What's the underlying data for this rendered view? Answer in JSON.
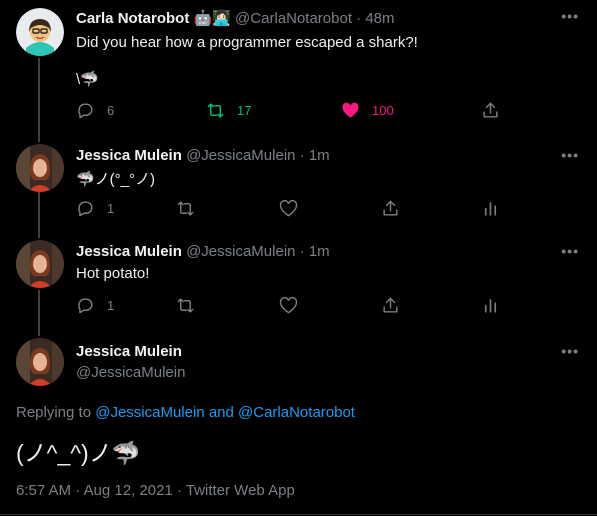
{
  "tweets": [
    {
      "name": "Carla Notarobot",
      "badges": "🤖👩🏻‍💻",
      "handle": "@CarlaNotarobot",
      "time": "48m",
      "text": "Did you hear how a programmer escaped a shark?!",
      "text2": "\\🦈",
      "replies": "6",
      "retweets": "17",
      "likes": "100"
    },
    {
      "name": "Jessica Mulein",
      "handle": "@JessicaMulein",
      "time": "1m",
      "text": "🦈ノ(°_°ノ)",
      "replies": "1"
    },
    {
      "name": "Jessica Mulein",
      "handle": "@JessicaMulein",
      "time": "1m",
      "text": "Hot potato!",
      "replies": "1"
    }
  ],
  "focus": {
    "name": "Jessica Mulein",
    "handle": "@JessicaMulein",
    "replying_prefix": "Replying to ",
    "replying_user1": "@JessicaMulein",
    "replying_and": " and ",
    "replying_user2": "@CarlaNotarobot",
    "text": "(ノ^_^)ノ🦈",
    "timestamp": "6:57 AM · Aug 12, 2021 · Twitter Web App"
  },
  "dot_sep": "·",
  "more_glyph": "•••",
  "colors": {
    "background": "#000000",
    "retweet_active": "#00ba7c",
    "like_active": "#f91880",
    "link": "#1d9bf0",
    "muted": "#7b8085"
  },
  "icons": [
    "reply-icon",
    "retweet-icon",
    "like-icon",
    "share-icon",
    "analytics-icon",
    "more-icon"
  ]
}
